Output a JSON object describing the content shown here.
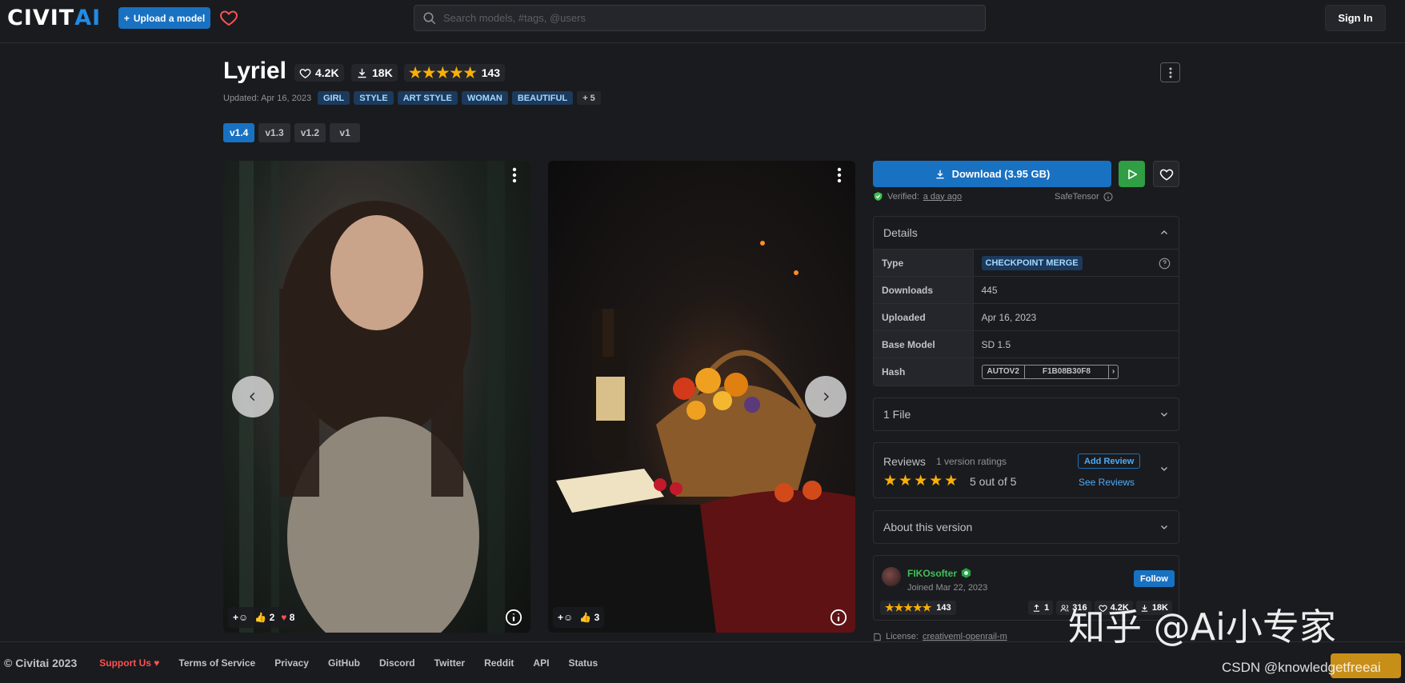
{
  "header": {
    "logo_main": "CIVIT",
    "logo_accent": "AI",
    "upload_label": "Upload a model",
    "search_placeholder": "Search models, #tags, @users",
    "signin_label": "Sign In"
  },
  "model": {
    "title": "Lyriel",
    "likes": "4.2K",
    "downloads": "18K",
    "rating_stars": "★★★★★",
    "rating_count": "143",
    "updated": "Updated: Apr 16, 2023",
    "tags": [
      "GIRL",
      "STYLE",
      "ART STYLE",
      "WOMAN",
      "BEAUTIFUL"
    ],
    "tags_more": "+ 5",
    "versions": [
      "v1.4",
      "v1.3",
      "v1.2",
      "v1"
    ],
    "active_version": "v1.4"
  },
  "gallery": {
    "card1": {
      "plus": "+",
      "thumbs_count": "2",
      "hearts_count": "8"
    },
    "card2": {
      "plus": "+",
      "thumbs_count": "3"
    }
  },
  "download": {
    "label": "Download (3.95 GB)",
    "verified_prefix": "Verified:",
    "verified_time": "a day ago",
    "safetensor": "SafeTensor"
  },
  "details": {
    "header": "Details",
    "rows": {
      "type_label": "Type",
      "type_value": "CHECKPOINT MERGE",
      "downloads_label": "Downloads",
      "downloads_value": "445",
      "uploaded_label": "Uploaded",
      "uploaded_value": "Apr 16, 2023",
      "base_label": "Base Model",
      "base_value": "SD 1.5",
      "hash_label": "Hash",
      "hash_type": "AUTOV2",
      "hash_value": "F1B08B30F8"
    }
  },
  "files": {
    "header": "1 File"
  },
  "reviews": {
    "title": "Reviews",
    "subtitle": "1 version ratings",
    "stars": "★★★★★",
    "score": "5 out of 5",
    "add_label": "Add Review",
    "see_label": "See Reviews"
  },
  "about": {
    "header": "About this version"
  },
  "creator": {
    "name": "FIKOsofter",
    "joined": "Joined Mar 22, 2023",
    "follow_label": "Follow",
    "stars": "★★★★★",
    "rating_count": "143",
    "uploads": "1",
    "followers": "316",
    "likes": "4.2K",
    "downloads": "18K"
  },
  "license": {
    "prefix": "License:",
    "value": "creativeml-openrail-m"
  },
  "footer": {
    "copyright": "© Civitai 2023",
    "support": "Support Us",
    "links": [
      "Terms of Service",
      "Privacy",
      "GitHub",
      "Discord",
      "Twitter",
      "Reddit",
      "API",
      "Status"
    ]
  },
  "watermark": {
    "zhihu": "知乎 @Ai小专家",
    "csdn": "CSDN @knowledgetfreeai"
  },
  "colors": {
    "background": "#1a1b1e",
    "primary": "#1971c2",
    "star": "#fab005",
    "success": "#2f9e44",
    "creator_name": "#40c057"
  }
}
